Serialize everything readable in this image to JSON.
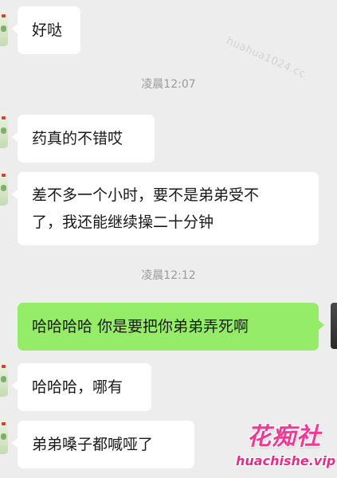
{
  "watermark": "huahua1024.cc",
  "messages": [
    {
      "side": "in",
      "lines": [
        "好哒"
      ]
    },
    {
      "timestamp": "凌晨12:07"
    },
    {
      "side": "in",
      "lines": [
        "药真的不错哎"
      ]
    },
    {
      "side": "in",
      "lines": [
        "差不多一个小时，要不是弟弟受不",
        "了，我还能继续操二十分钟"
      ]
    },
    {
      "timestamp": "凌晨12:12"
    },
    {
      "side": "out",
      "lines": [
        "哈哈哈哈 你是要把你弟弟弄死啊"
      ]
    },
    {
      "side": "in",
      "lines": [
        "哈哈哈，哪有"
      ]
    },
    {
      "side": "in",
      "lines": [
        "弟弟嗓子都喊哑了"
      ]
    }
  ],
  "logo": {
    "name": "花痴社",
    "url": "huachishe.vip"
  },
  "colors": {
    "background": "#ededed",
    "incoming_bubble": "#ffffff",
    "outgoing_bubble": "#95ec69",
    "timestamp_text": "#9a9a9a",
    "logo": "#f23a95"
  }
}
